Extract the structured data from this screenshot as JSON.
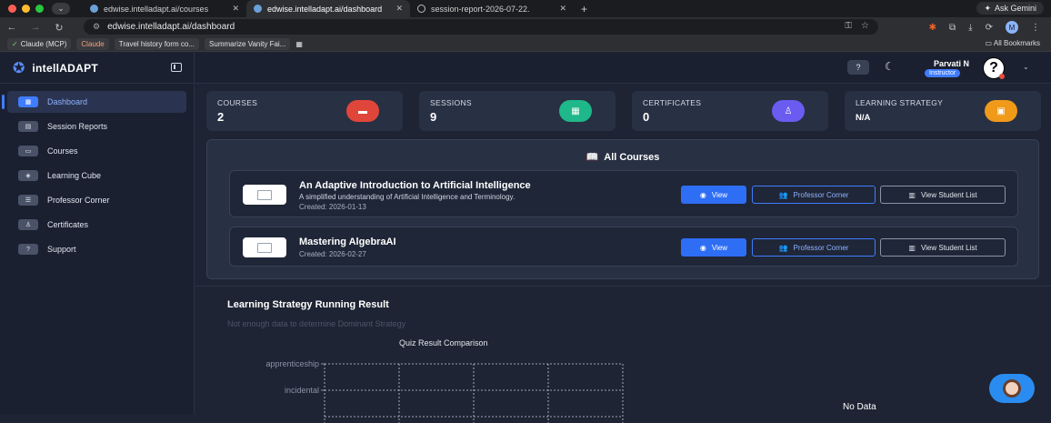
{
  "browser": {
    "tabs": [
      {
        "title": "edwise.intelladapt.ai/courses",
        "active": false
      },
      {
        "title": "edwise.intelladapt.ai/dashboard",
        "active": true
      },
      {
        "title": "session-report-2026-07-22.",
        "active": false
      }
    ],
    "new_tab": "+",
    "ask_gemini": "Ask Gemini",
    "url": "edwise.intelladapt.ai/dashboard",
    "avatar_letter": "M",
    "bookmarks": [
      "Claude (MCP)",
      "Claude",
      "Travel history form co...",
      "Summarize Vanity Fai..."
    ],
    "all_bookmarks": "All Bookmarks"
  },
  "app": {
    "brand": "intellADAPT",
    "nav": [
      {
        "label": "Dashboard",
        "icon": "dashboard-icon",
        "glyph": "▦",
        "active": true
      },
      {
        "label": "Session Reports",
        "icon": "report-icon",
        "glyph": "▤",
        "active": false
      },
      {
        "label": "Courses",
        "icon": "course-icon",
        "glyph": "▭",
        "active": false
      },
      {
        "label": "Learning Cube",
        "icon": "cube-icon",
        "glyph": "◈",
        "active": false
      },
      {
        "label": "Professor Corner",
        "icon": "chart-icon",
        "glyph": "☰",
        "active": false
      },
      {
        "label": "Certificates",
        "icon": "certificate-icon",
        "glyph": "♙",
        "active": false
      },
      {
        "label": "Support",
        "icon": "support-icon",
        "glyph": "?",
        "active": false
      }
    ],
    "user": {
      "name": "Parvati N",
      "role": "Instructor",
      "avatar": "?"
    }
  },
  "stats": [
    {
      "label": "COURSES",
      "value": "2",
      "icon": "course-icon",
      "color": "#e0453a"
    },
    {
      "label": "SESSIONS",
      "value": "9",
      "icon": "sessions-icon",
      "color": "#1fb88a"
    },
    {
      "label": "CERTIFICATES",
      "value": "0",
      "icon": "certificate-icon",
      "color": "#6a5cf0"
    },
    {
      "label": "LEARNING STRATEGY",
      "value": "N/A",
      "icon": "strategy-icon",
      "color": "#f09a1a"
    }
  ],
  "courses_panel": {
    "title": "All Courses",
    "courses": [
      {
        "title": "An Adaptive Introduction to Artificial Intelligence",
        "description": "A simplified understanding of Artificial Intelligence and Terminology.",
        "created": "Created: 2026-01-13"
      },
      {
        "title": "Mastering AlgebraAI",
        "description": "",
        "created": "Created: 2026-02-27"
      }
    ],
    "buttons": {
      "view": "View",
      "professor_corner": "Professor Corner",
      "student_list": "View Student List"
    }
  },
  "strategy": {
    "title": "Learning Strategy Running Result",
    "note": "Not enough data to determine Dominant Strategy",
    "no_data": "No Data"
  },
  "chart_data": {
    "type": "bar",
    "title": "Quiz Result Comparison",
    "categories": [
      "apprenticeship",
      "incidental"
    ],
    "series": [],
    "grid": true,
    "xlabel": "",
    "ylabel": ""
  }
}
